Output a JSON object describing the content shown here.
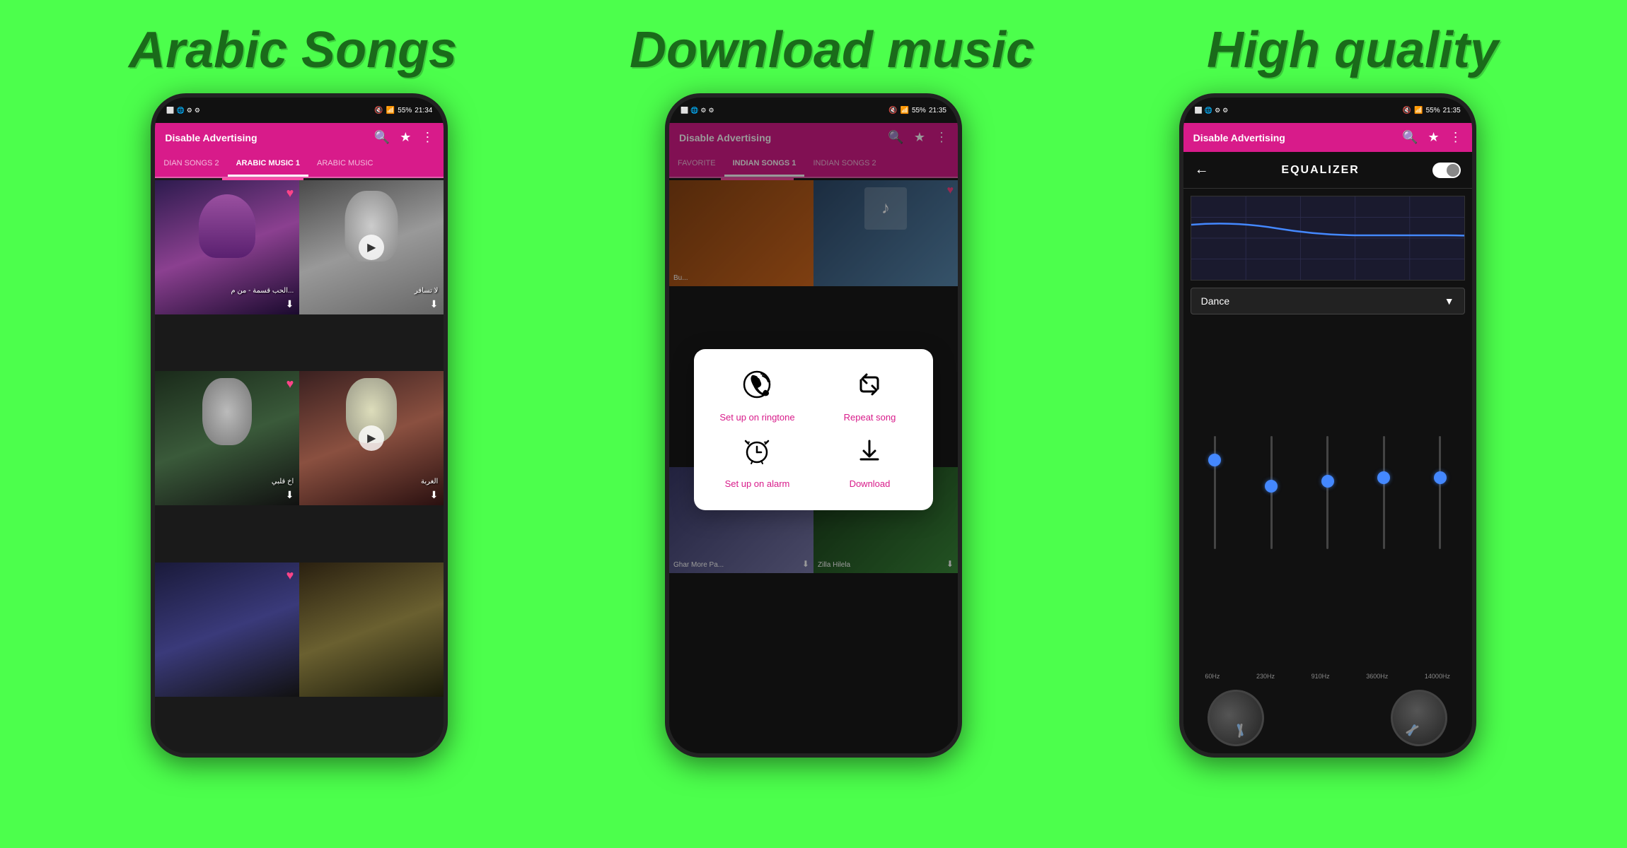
{
  "background_color": "#4cff4c",
  "titles": {
    "left": "Arabic Songs",
    "middle": "Download music",
    "right": "High quality"
  },
  "phone1": {
    "status_bar": {
      "time": "21:34",
      "battery": "55%"
    },
    "toolbar": {
      "title": "Disable Advertising",
      "search_icon": "🔍",
      "star_icon": "★",
      "more_icon": "⋮"
    },
    "tabs": [
      {
        "label": "DIAN SONGS 2",
        "active": false
      },
      {
        "label": "ARABIC MUSIC 1",
        "active": true
      },
      {
        "label": "ARABIC MUSIC",
        "active": false
      }
    ],
    "songs": [
      {
        "title": "الحب قسمة - من م...",
        "has_heart": true,
        "has_download": true,
        "has_play": false
      },
      {
        "title": "لا تسافر",
        "has_heart": false,
        "has_download": true,
        "has_play": true
      },
      {
        "title": "اخ قلبي",
        "has_heart": true,
        "has_download": true,
        "has_play": false
      },
      {
        "title": "الغربة",
        "has_heart": false,
        "has_download": true,
        "has_play": true
      },
      {
        "title": "",
        "has_heart": true,
        "has_download": false,
        "has_play": false
      },
      {
        "title": "",
        "has_heart": false,
        "has_download": false,
        "has_play": false
      }
    ]
  },
  "phone2": {
    "status_bar": {
      "time": "21:35",
      "battery": "55%"
    },
    "toolbar": {
      "title": "Disable Advertising"
    },
    "tabs": [
      {
        "label": "FAVORITE",
        "active": false
      },
      {
        "label": "INDIAN SONGS 1",
        "active": true
      },
      {
        "label": "INDIAN SONGS 2",
        "active": false
      }
    ],
    "context_menu": {
      "items": [
        {
          "icon": "📞",
          "label": "Set up on ringtone"
        },
        {
          "icon": "🔄",
          "label": "Repeat song"
        },
        {
          "icon": "⏰",
          "label": "Set up on alarm"
        },
        {
          "icon": "⬇",
          "label": "Download"
        }
      ]
    },
    "songs": [
      {
        "title": "Bu...",
        "has_heart": false
      },
      {
        "title": "",
        "has_heart": true
      },
      {
        "title": "Ghar More Pa...",
        "has_heart": false,
        "has_download": true
      },
      {
        "title": "Zilla Hilela",
        "has_heart": false,
        "has_download": true
      }
    ]
  },
  "phone3": {
    "status_bar": {
      "time": "21:35",
      "battery": "55%"
    },
    "toolbar": {
      "title": "Disable Advertising"
    },
    "equalizer": {
      "title": "EQUALIZER",
      "preset": "Dance",
      "freqs": [
        "60Hz",
        "230Hz",
        "910Hz",
        "3600Hz",
        "14000Hz"
      ],
      "knob_positions": [
        30,
        55,
        50,
        45,
        45
      ]
    }
  }
}
